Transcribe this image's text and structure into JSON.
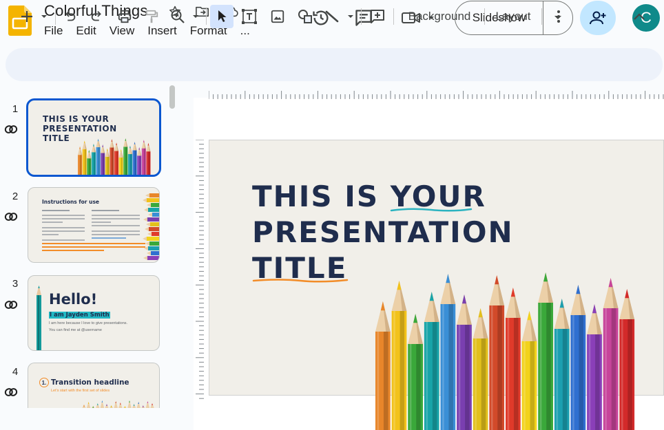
{
  "app": {
    "doc_title": "Colorful Things",
    "menu": [
      "File",
      "Edit",
      "View",
      "Insert",
      "Format",
      "..."
    ],
    "slideshow_label": "Slideshow",
    "avatar_letter": "C"
  },
  "toolbar": {
    "background_label": "Background",
    "layout_label": "Layout"
  },
  "colors": {
    "accent": "#0b57d0",
    "title_navy": "#1f2d4d",
    "underline_teal": "#2bb3c0",
    "underline_orange": "#f28c28",
    "slide_bg": "#f1efe9",
    "avatar": "#0f8a8a",
    "share_bg": "#c2e7ff"
  },
  "slides": [
    {
      "num": "1",
      "title_lines": [
        "THIS IS YOUR",
        "PRESENTATION",
        "TITLE"
      ]
    },
    {
      "num": "2",
      "heading": "Instructions for use"
    },
    {
      "num": "3",
      "heading": "Hello!",
      "name_line": "I am Jayden Smith",
      "line2": "I am here because I love to give presentations.",
      "line3": "You can find me at @username"
    },
    {
      "num": "4",
      "index": "1.",
      "heading": "Transition headline",
      "subtitle": "Let's start with the first set of slides"
    }
  ],
  "main_slide": {
    "title_lines": [
      "THIS IS YOUR",
      "PRESENTATION",
      "TITLE"
    ]
  }
}
